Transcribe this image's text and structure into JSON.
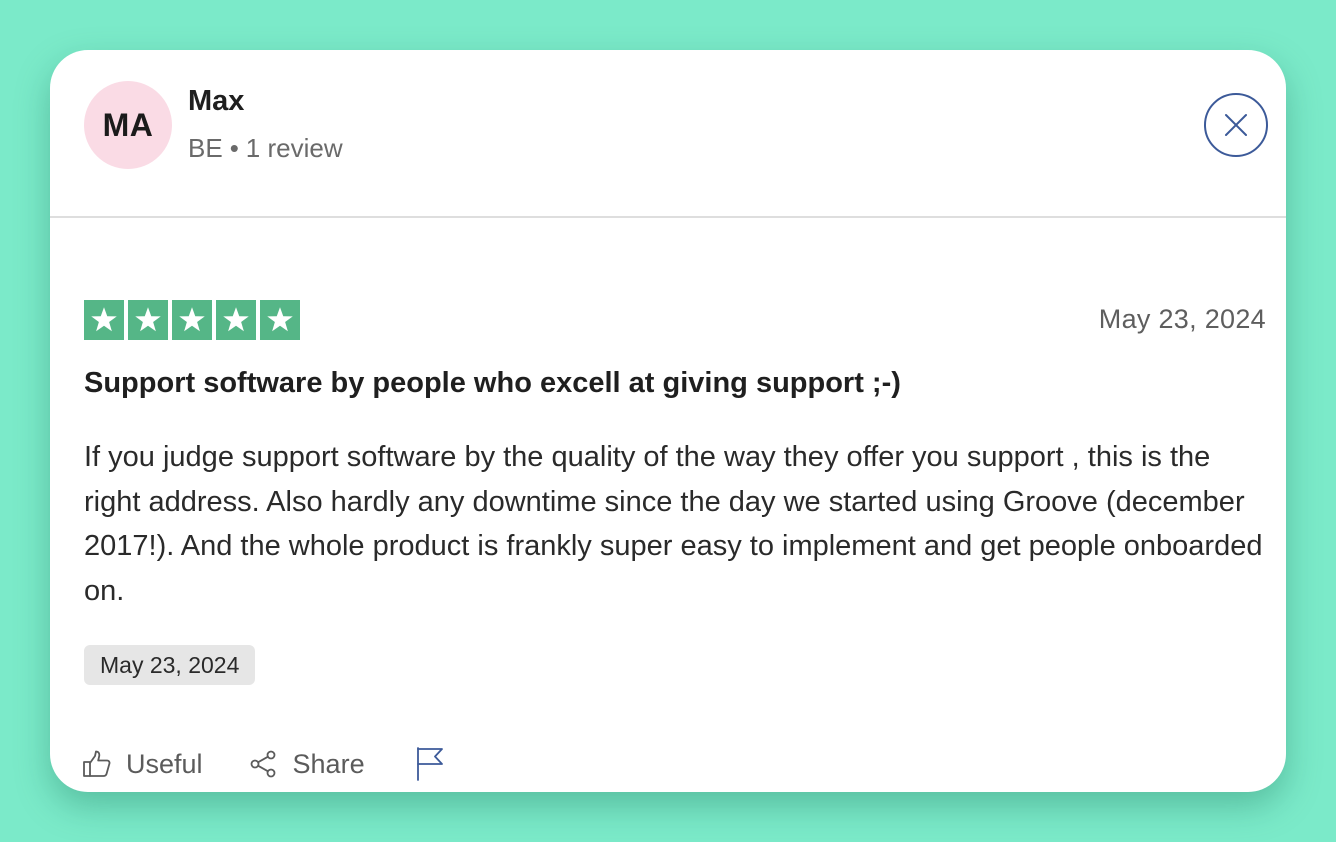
{
  "reviewer": {
    "initials": "MA",
    "name": "Max",
    "country": "BE",
    "separator": "•",
    "review_count": "1 review"
  },
  "review": {
    "rating": 5,
    "rating_max": 5,
    "date": "May 23, 2024",
    "title": "Support software by people who excell at giving support ;-)",
    "body": "If you judge support software by the quality of the way they offer you support , this is the right address. Also hardly any downtime since the day we started using Groove (december 2017!). And the whole product is frankly super easy to implement and get people onboarded on.",
    "experience_date": "May 23, 2024"
  },
  "actions": {
    "useful_label": "Useful",
    "share_label": "Share",
    "report_icon": "flag-icon"
  },
  "icons": {
    "close": "close-icon",
    "star": "star-icon",
    "useful": "thumbs-up-icon",
    "share": "share-icon"
  },
  "colors": {
    "background": "#7beac9",
    "avatar_bg": "#fadbe5",
    "star_green": "#55b687",
    "close_ring": "#3c5a99",
    "badge_bg": "#e6e6e6"
  }
}
